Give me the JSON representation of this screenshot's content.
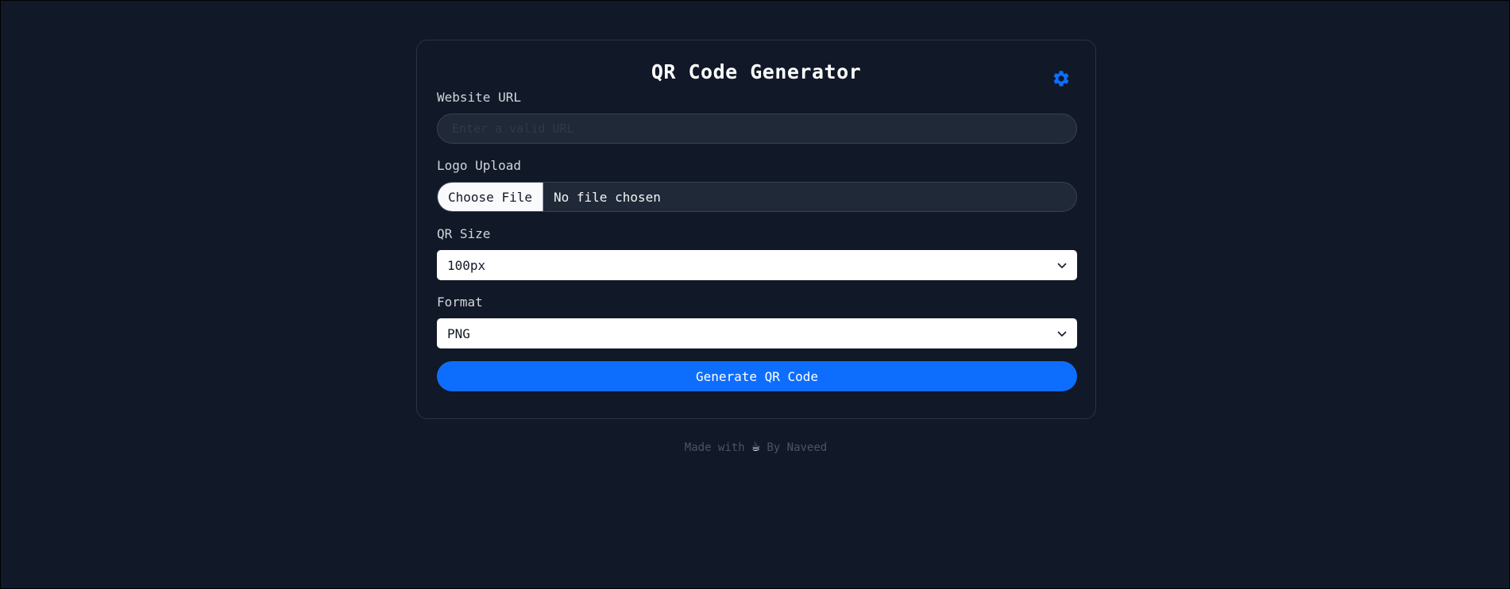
{
  "card": {
    "title": "QR Code Generator",
    "settings_icon": "gear-icon",
    "url_label": "Website URL",
    "url_value": "",
    "url_placeholder": "Enter a valid URL",
    "logo_label": "Logo Upload",
    "file_button": "Choose File",
    "file_status": "No file chosen",
    "size_label": "QR Size",
    "size_value": "100px",
    "format_label": "Format",
    "format_value": "PNG",
    "generate_label": "Generate QR Code"
  },
  "footer": {
    "made_with": "Made with",
    "cup": "☕",
    "by": "By Naveed"
  },
  "colors": {
    "background": "#111827",
    "accent": "#0d6efd",
    "input_bg": "#1f2937"
  }
}
